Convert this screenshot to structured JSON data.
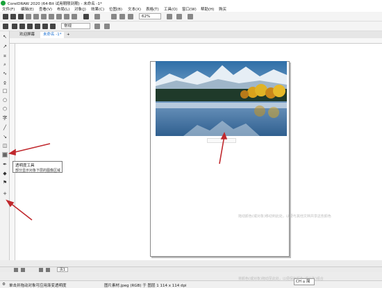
{
  "window": {
    "title": "CorelDRAW 2020 (64-Bit 试用期限到期) - 未命名 -1*"
  },
  "menu": [
    "文件(F)",
    "编辑(E)",
    "查看(V)",
    "布局(L)",
    "对象(J)",
    "效果(C)",
    "位图(B)",
    "文本(X)",
    "表格(T)",
    "工具(O)",
    "窗口(W)",
    "帮助(H)",
    "购买"
  ],
  "toolbar": {
    "zoom_value": "62%",
    "style_value": "常规"
  },
  "tabs": {
    "welcome": "欢迎屏幕",
    "document": "未命名 -1*",
    "add": "+"
  },
  "tooltip": {
    "title": "透明度工具",
    "description": "部分显示对象下层的图像区域"
  },
  "page_tab": "页1",
  "hints": {
    "canvas_hint": "拖动颜色(或对象)移动到此处，以便与其他文档共享这些颜色",
    "bottom_hint": "将颜色(或对象)拖动至此处，以便保存颜色(或对象)组合"
  },
  "status": {
    "left": "单击并拖动对象可应用渐变透明度",
    "info": "图片素材.jpeg (RGB) 于 图层 1 114 x 114 dpi",
    "ime": "CH ⌂ 简"
  },
  "colors": {
    "accent": "#1a6fd1",
    "arrow": "#c0282d",
    "brand": "#1aa33a"
  },
  "icons": [
    "corel-logo-icon",
    "new-icon",
    "open-icon",
    "save-icon",
    "print-icon",
    "undo-icon",
    "redo-icon",
    "pick-tool-icon",
    "shape-tool-icon",
    "crop-icon",
    "zoom-icon",
    "freehand-icon",
    "rectangle-icon",
    "ellipse-icon",
    "polygon-icon",
    "text-icon",
    "parallel-dimension-icon",
    "connector-icon",
    "shadow-icon",
    "transparency-icon",
    "eyedropper-icon",
    "fill-icon",
    "smart-fill-icon",
    "add-icon"
  ]
}
